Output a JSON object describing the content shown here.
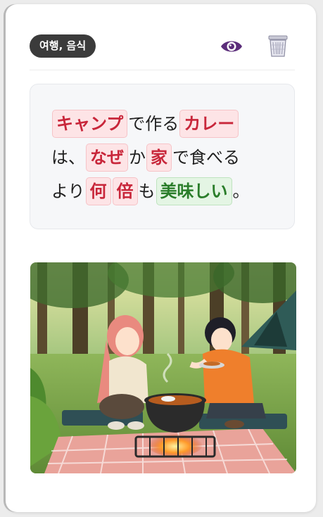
{
  "header": {
    "tag_label": "여행, 음식",
    "eye_icon": "eye-icon",
    "trash_icon": "trash-icon"
  },
  "sentence": {
    "line1": [
      {
        "text": "キャンプ",
        "kind": "word",
        "color": "red"
      },
      {
        "text": "で作る",
        "kind": "plain"
      },
      {
        "text": "カレー",
        "kind": "word",
        "color": "red"
      }
    ],
    "line2": [
      {
        "text": "は、",
        "kind": "plain"
      },
      {
        "text": "なぜ",
        "kind": "word",
        "color": "red"
      },
      {
        "text": "か",
        "kind": "plain"
      },
      {
        "text": "家",
        "kind": "word",
        "color": "red"
      },
      {
        "text": "で食べる",
        "kind": "plain"
      }
    ],
    "line3": [
      {
        "text": "より",
        "kind": "plain"
      },
      {
        "text": "何",
        "kind": "word",
        "color": "red"
      },
      {
        "text": "倍",
        "kind": "word",
        "color": "red"
      },
      {
        "text": "も",
        "kind": "plain"
      },
      {
        "text": "美味しい",
        "kind": "word",
        "color": "green"
      },
      {
        "text": "。",
        "kind": "plain"
      }
    ]
  },
  "colors": {
    "tag_bg": "#3b3b3b",
    "eye": "#5b2d7a",
    "word_red_text": "#c8263a",
    "word_red_bg": "#fde4e6",
    "word_green_text": "#2a7d2a",
    "word_green_bg": "#e4f5e4"
  },
  "illustration": {
    "subject": "camp-curry-illustration"
  }
}
